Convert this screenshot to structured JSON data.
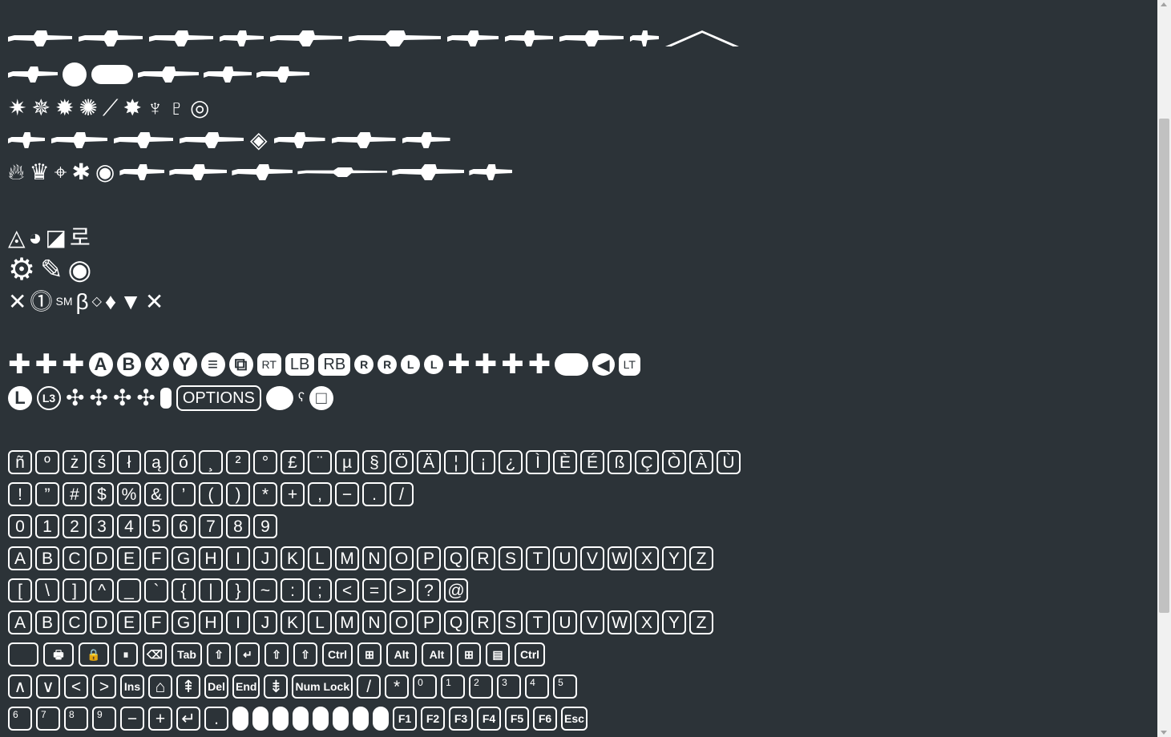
{
  "weapon_rows": [
    [
      "⬤",
      "⬤",
      "⬤",
      "⬤",
      "⬤",
      "⬤",
      "⬤",
      "⬤",
      "⬤",
      "⬤",
      "⬤"
    ],
    [],
    [],
    [],
    []
  ],
  "symbols": {
    "row1": [
      "◬",
      "◕",
      "◪",
      "로"
    ],
    "row2": [
      "⚙",
      "✎",
      "◉"
    ],
    "row3": [
      "✕",
      "⓵",
      "SM",
      "β",
      "◇",
      "♦",
      "▼",
      "✕"
    ]
  },
  "controller": {
    "row1_circles": [
      "A",
      "B",
      "X",
      "Y",
      "≡",
      "⧉"
    ],
    "row1_pills": [
      "RT",
      "LB",
      "RB"
    ],
    "row1_small": [
      "R",
      "R",
      "L",
      "L"
    ],
    "row1_end": [
      "◀",
      "LT"
    ],
    "row2_circles": [
      "L",
      "L3"
    ],
    "row2_options": "OPTIONS",
    "row2_end": [
      "ʕ",
      "□"
    ]
  },
  "keys": {
    "accents": [
      "ñ",
      "º",
      "ż",
      "ś",
      "ł",
      "ą",
      "ó",
      "¸",
      "²",
      "°",
      "£",
      "¨",
      "µ",
      "§",
      "Ö",
      "Ä",
      "¦",
      "¡",
      "¿",
      "Ì",
      "È",
      "É",
      "ß",
      "Ç",
      "Ò",
      "À",
      "Ù"
    ],
    "punct": [
      "!",
      "”",
      "#",
      "$",
      "%",
      "&",
      "’",
      "(",
      ")",
      "*",
      "+",
      ",",
      "−",
      ".",
      "/"
    ],
    "digits": [
      "0",
      "1",
      "2",
      "3",
      "4",
      "5",
      "6",
      "7",
      "8",
      "9"
    ],
    "upper": [
      "A",
      "B",
      "C",
      "D",
      "E",
      "F",
      "G",
      "H",
      "I",
      "J",
      "K",
      "L",
      "M",
      "N",
      "O",
      "P",
      "Q",
      "R",
      "S",
      "T",
      "U",
      "V",
      "W",
      "X",
      "Y",
      "Z"
    ],
    "brackets": [
      "[",
      "\\",
      "]",
      "^",
      "_",
      "`",
      "{",
      "|",
      "}",
      "~",
      ":",
      ";",
      "<",
      "=",
      ">",
      "?",
      "@"
    ],
    "upper2": [
      "A",
      "B",
      "C",
      "D",
      "E",
      "F",
      "G",
      "H",
      "I",
      "J",
      "K",
      "L",
      "M",
      "N",
      "O",
      "P",
      "Q",
      "R",
      "S",
      "T",
      "U",
      "V",
      "W",
      "X",
      "Y",
      "Z"
    ],
    "special1": [
      "",
      "🖶",
      "🔒",
      "⏸",
      "⌫",
      "Tab",
      "⇧",
      "↵",
      "⇧",
      "⇧",
      "Ctrl",
      "⊞",
      "Alt",
      "Alt",
      "⊞",
      "▤",
      "Ctrl"
    ],
    "special2": [
      "∧",
      "∨",
      "<",
      ">",
      "Ins",
      "⌂",
      "⇞",
      "Del",
      "End",
      "⇟",
      "Num Lock",
      "/",
      "*",
      "0",
      "1",
      "2",
      "3",
      "4",
      "5"
    ],
    "special3": [
      "6",
      "7",
      "8",
      "9",
      "−",
      "+",
      "↵",
      "."
    ],
    "mice": [
      "",
      "",
      "",
      "",
      "",
      "",
      "",
      ""
    ],
    "fkeys": [
      "F1",
      "F2",
      "F3",
      "F4",
      "F5",
      "F6",
      "Esc"
    ]
  }
}
